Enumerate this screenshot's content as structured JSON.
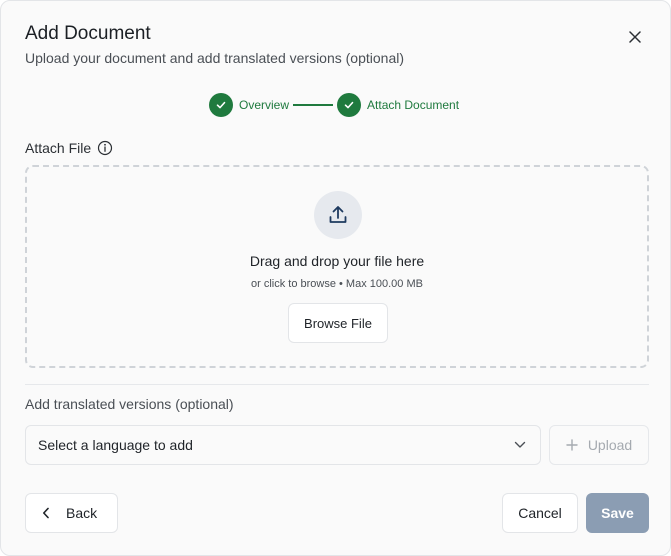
{
  "dialog": {
    "title": "Add Document",
    "subtitle": "Upload your document and add translated versions (optional)"
  },
  "stepper": {
    "steps": [
      {
        "label": "Overview",
        "status": "complete"
      },
      {
        "label": "Attach Document",
        "status": "complete"
      }
    ],
    "accent_color": "#1f7a3e"
  },
  "attach": {
    "label": "Attach File",
    "drop_title": "Drag and drop your file here",
    "drop_hint": "or click to browse • Max 100.00 MB",
    "browse_label": "Browse File"
  },
  "translations": {
    "label": "Add translated versions (optional)",
    "select_placeholder": "Select a language to add",
    "upload_label": "Upload"
  },
  "footer": {
    "back_label": "Back",
    "cancel_label": "Cancel",
    "save_label": "Save"
  },
  "icons": {
    "close": "close-icon",
    "check": "check-icon",
    "info": "info-icon",
    "upload": "upload-icon",
    "chevron": "chevron-down-icon",
    "plus": "plus-icon",
    "back": "chevron-left-icon"
  },
  "colors": {
    "save_disabled": "#8b9db3",
    "upload_circle": "#e6e9ee",
    "upload_icon": "#1e3a5f"
  }
}
